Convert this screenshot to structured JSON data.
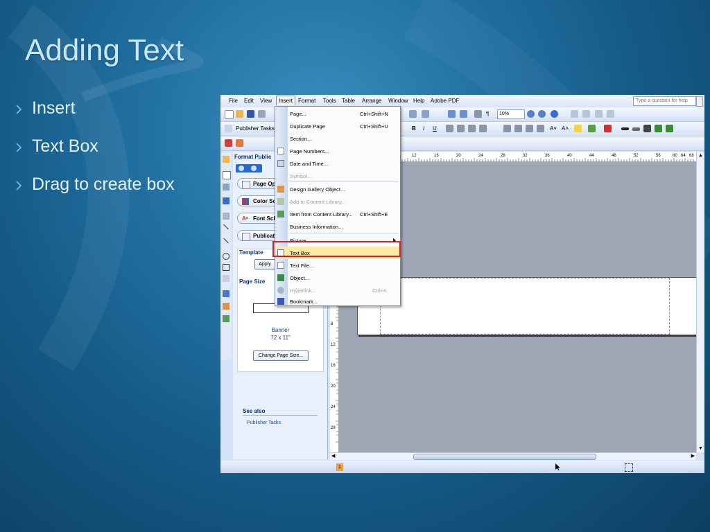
{
  "slide": {
    "title": "Adding Text",
    "bullets": [
      "Insert",
      "Text Box",
      "Drag to create box"
    ]
  },
  "app": {
    "menubar": [
      "File",
      "Edit",
      "View",
      "Insert",
      "Format",
      "Tools",
      "Table",
      "Arrange",
      "Window",
      "Help",
      "Adobe PDF"
    ],
    "active_menu": "Insert",
    "help_placeholder": "Type a question for help",
    "zoom": "10%",
    "publisher_tasks_label": "Publisher Tasks",
    "taskpane": {
      "title": "Format Public",
      "tabs": [
        "Page Opt",
        "Color Sch",
        "Font Sch",
        "Publicati"
      ],
      "template_label": "Template",
      "apply_label": "Apply",
      "page_size_label": "Page Size",
      "page_size_name": "Banner",
      "page_size_dims": "72 x 11\"",
      "change_page_size": "Change Page Size...",
      "see_also": "See also",
      "publisher_tasks_link": "Publisher Tasks"
    },
    "ruler_numbers": [
      "12",
      "16",
      "20",
      "24",
      "28",
      "32",
      "36",
      "40",
      "44",
      "48",
      "52",
      "56",
      "60",
      "64",
      "68"
    ],
    "ruler_left_numbers": [
      "8",
      "12",
      "16",
      "20",
      "24",
      "28"
    ],
    "page_number": "1",
    "insert_menu": [
      {
        "label": "Page...",
        "shortcut": "Ctrl+Shift+N",
        "disabled": false
      },
      {
        "label": "Duplicate Page",
        "shortcut": "Ctrl+Shift+U",
        "disabled": false
      },
      {
        "label": "Section...",
        "shortcut": "",
        "disabled": false
      },
      {
        "label": "Page Numbers...",
        "shortcut": "",
        "disabled": false
      },
      {
        "label": "Date and Time...",
        "shortcut": "",
        "disabled": false
      },
      {
        "label": "Symbol...",
        "shortcut": "",
        "disabled": true
      },
      {
        "label": "Design Gallery Object...",
        "shortcut": "",
        "disabled": false
      },
      {
        "label": "Add to Content Library...",
        "shortcut": "",
        "disabled": true
      },
      {
        "label": "Item from Content Library...",
        "shortcut": "Ctrl+Shift+E",
        "disabled": false
      },
      {
        "label": "Business Information...",
        "shortcut": "",
        "disabled": false
      },
      {
        "label": "Picture",
        "shortcut": "",
        "disabled": false
      },
      {
        "label": "Text Box",
        "shortcut": "",
        "disabled": false
      },
      {
        "label": "Text File...",
        "shortcut": "",
        "disabled": false
      },
      {
        "label": "Object...",
        "shortcut": "",
        "disabled": false
      },
      {
        "label": "Hyperlink...",
        "shortcut": "Ctrl+K",
        "disabled": true
      },
      {
        "label": "Bookmark...",
        "shortcut": "",
        "disabled": false
      }
    ],
    "highlighted_item": "Text Box"
  },
  "colors": {
    "accent": "#2372a4",
    "highlight": "#ffe9a6",
    "callout": "#d01e2a"
  }
}
